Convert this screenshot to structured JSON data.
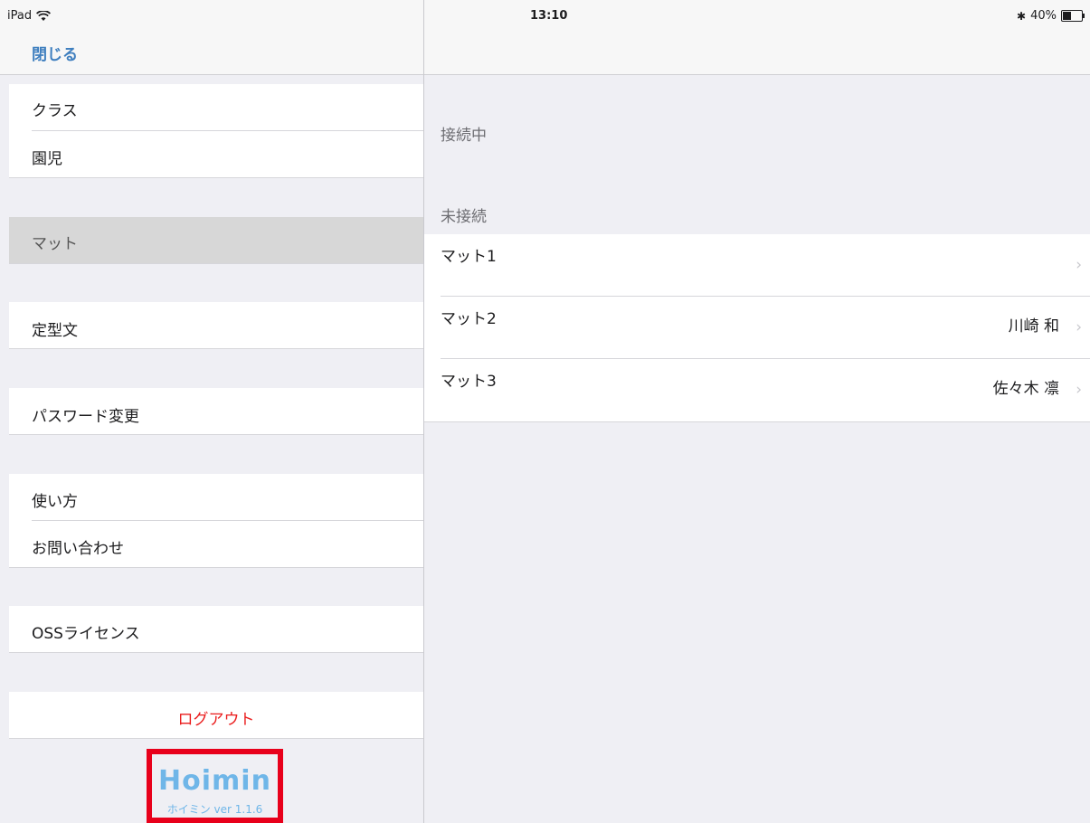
{
  "status_bar": {
    "device": "iPad",
    "time": "13:10",
    "battery": "40%"
  },
  "sidebar": {
    "close_label": "閉じる",
    "items": [
      {
        "label": "クラス"
      },
      {
        "label": "園児"
      },
      {
        "label": "マット",
        "selected": true
      },
      {
        "label": "定型文"
      },
      {
        "label": "パスワード変更"
      },
      {
        "label": "使い方"
      },
      {
        "label": "お問い合わせ"
      },
      {
        "label": "OSSライセンス"
      }
    ],
    "logout_label": "ログアウト",
    "logo": {
      "name": "Hoimin",
      "version_text": "ホイミン ver 1.1.6"
    }
  },
  "detail": {
    "section_connected": "接続中",
    "section_unconnected": "未接続",
    "mats": [
      {
        "name": "マット1",
        "assigned": ""
      },
      {
        "name": "マット2",
        "assigned": "川崎 和"
      },
      {
        "name": "マット3",
        "assigned": "佐々木 凛"
      }
    ]
  },
  "colors": {
    "accent": "#3f7fbf",
    "logout": "#ea1c1c",
    "logo": "#6fb6e8",
    "highlight_box": "#e8001b"
  }
}
